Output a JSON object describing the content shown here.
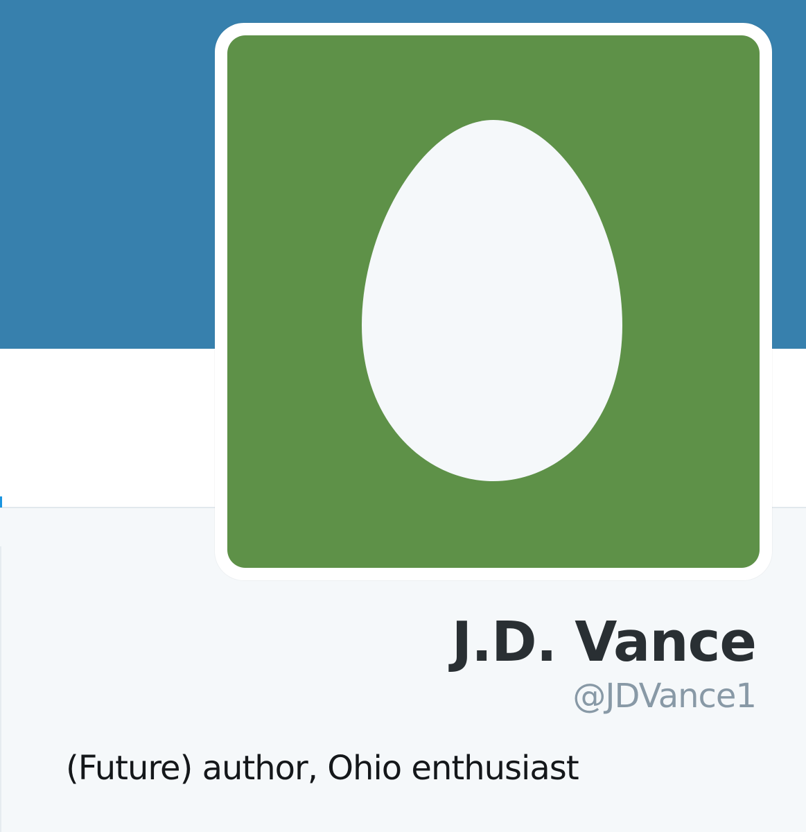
{
  "profile": {
    "name": "J.D. Vance",
    "handle": "@JDVance1",
    "bio": "(Future) author, Ohio enthusiast",
    "avatar_icon": "default-egg-avatar"
  },
  "colors": {
    "header_banner": "#3780ad",
    "avatar_background": "#5e9148",
    "egg": "#f5f8fa",
    "name_text": "#292f33",
    "handle_text": "#8899a6",
    "page_background": "#f5f8fa"
  }
}
